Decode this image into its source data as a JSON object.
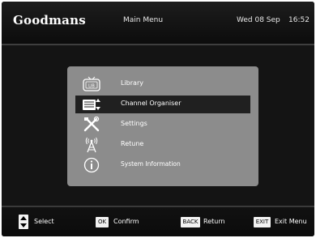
{
  "header": {
    "brand": "Goodmans",
    "title": "Main Menu",
    "date": "Wed 08 Sep",
    "time": "16:52"
  },
  "menu": {
    "selected_index": 1,
    "items": [
      {
        "label": "Library",
        "icon": "tv-lib-icon"
      },
      {
        "label": "Channel Organiser",
        "icon": "channel-list-icon"
      },
      {
        "label": "Settings",
        "icon": "tools-icon"
      },
      {
        "label": "Retune",
        "icon": "antenna-icon"
      },
      {
        "label": "System Information",
        "icon": "info-icon"
      }
    ]
  },
  "footer": {
    "select_label": "Select",
    "ok_key": "OK",
    "ok_label": "Confirm",
    "back_key": "BACK",
    "back_label": "Return",
    "exit_key": "EXIT",
    "exit_label": "Exit Menu"
  },
  "colors": {
    "screen_bg": "#141414",
    "panel_bg": "#8c8c8c",
    "selection_bg": "#202020",
    "text": "#ffffff"
  }
}
